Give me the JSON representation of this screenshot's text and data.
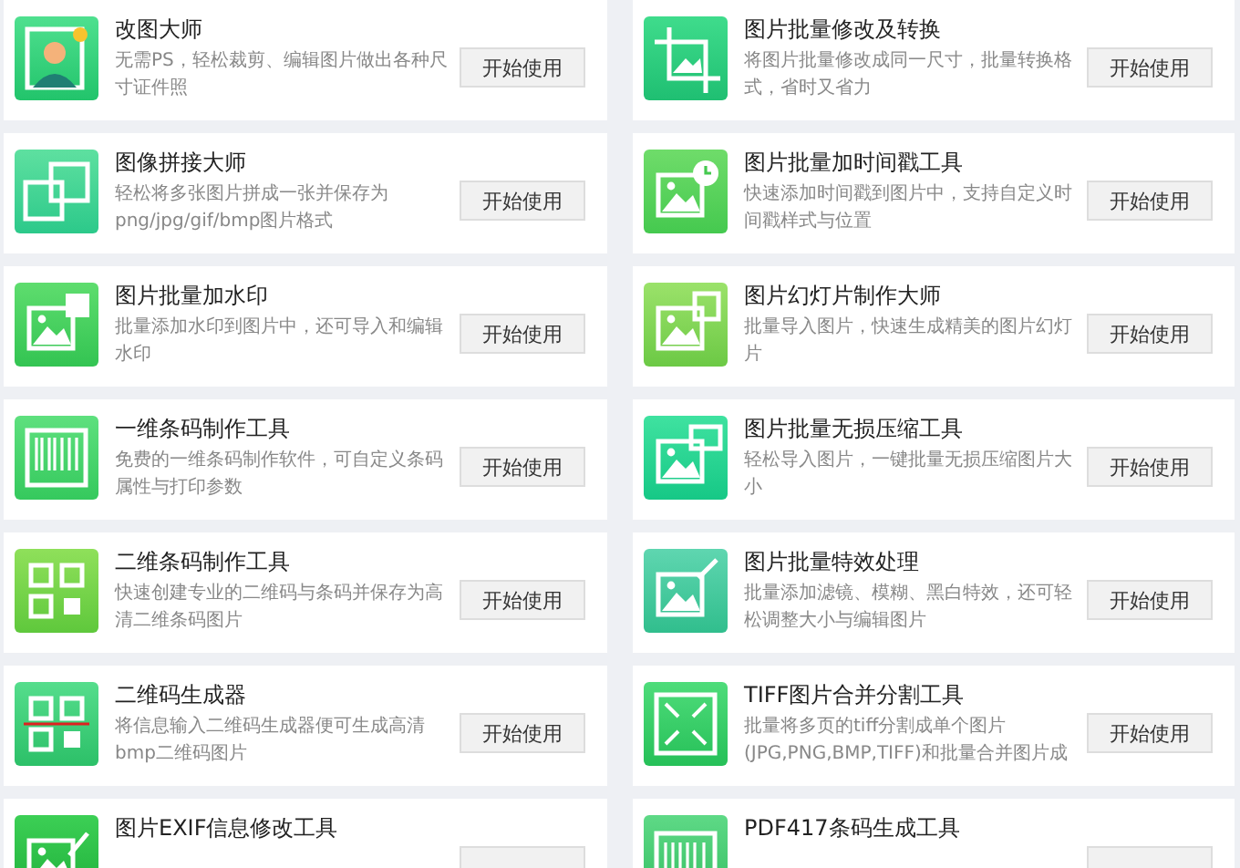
{
  "tools": [
    {
      "title": "改图大师",
      "description": "无需PS，轻松裁剪、编辑图片做出各种尺寸证件照",
      "button": "开始使用"
    },
    {
      "title": "图片批量修改及转换",
      "description": "将图片批量修改成同一尺寸，批量转换格式，省时又省力",
      "button": "开始使用"
    },
    {
      "title": "图像拼接大师",
      "description": "轻松将多张图片拼成一张并保存为png/jpg/gif/bmp图片格式",
      "button": "开始使用"
    },
    {
      "title": "图片批量加时间戳工具",
      "description": "快速添加时间戳到图片中，支持自定义时间戳样式与位置",
      "button": "开始使用"
    },
    {
      "title": "图片批量加水印",
      "description": "批量添加水印到图片中，还可导入和编辑水印",
      "button": "开始使用"
    },
    {
      "title": "图片幻灯片制作大师",
      "description": "批量导入图片，快速生成精美的图片幻灯片",
      "button": "开始使用"
    },
    {
      "title": "一维条码制作工具",
      "description": "免费的一维条码制作软件，可自定义条码属性与打印参数",
      "button": "开始使用"
    },
    {
      "title": "图片批量无损压缩工具",
      "description": "轻松导入图片，一键批量无损压缩图片大小",
      "button": "开始使用"
    },
    {
      "title": "二维条码制作工具",
      "description": "快速创建专业的二维码与条码并保存为高清二维条码图片",
      "button": "开始使用"
    },
    {
      "title": "图片批量特效处理",
      "description": "批量添加滤镜、模糊、黑白特效，还可轻松调整大小与编辑图片",
      "button": "开始使用"
    },
    {
      "title": "二维码生成器",
      "description": "将信息输入二维码生成器便可生成高清bmp二维码图片",
      "button": "开始使用"
    },
    {
      "title": "TIFF图片合并分割工具",
      "description": "批量将多页的tiff分割成单个图片(JPG,PNG,BMP,TIFF)和批量合并图片成",
      "button": "开始使用"
    },
    {
      "title": "图片EXIF信息修改工具"
    },
    {
      "title": "PDF417条码生成工具"
    }
  ]
}
